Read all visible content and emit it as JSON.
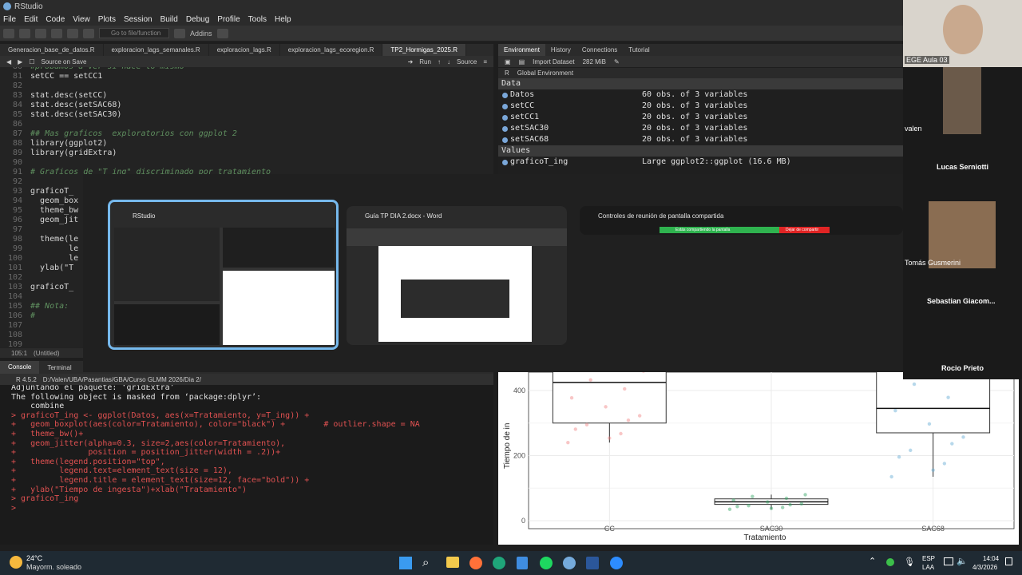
{
  "app": {
    "title": "RStudio"
  },
  "menu": [
    "File",
    "Edit",
    "Code",
    "View",
    "Plots",
    "Session",
    "Build",
    "Debug",
    "Profile",
    "Tools",
    "Help"
  ],
  "toolbar": {
    "goto_placeholder": "Go to file/function",
    "addins": "Addins"
  },
  "source": {
    "tabs": [
      "Generacion_base_de_datos.R",
      "exploracion_lags_semanales.R",
      "exploracion_lags.R",
      "exploracion_lags_ecoregion.R",
      "TP2_Hormigas_2025.R"
    ],
    "source_on_save": "Source on Save",
    "run": "Run",
    "source": "Source",
    "lines": [
      {
        "n": "80",
        "code": "#probamos a ver si hace lo mismo",
        "comment": true
      },
      {
        "n": "81",
        "code": "setCC == setCC1",
        "comment": false
      },
      {
        "n": "82",
        "code": "",
        "comment": false
      },
      {
        "n": "83",
        "code": "stat.desc(setCC)",
        "comment": false
      },
      {
        "n": "84",
        "code": "stat.desc(setSAC68)",
        "comment": false
      },
      {
        "n": "85",
        "code": "stat.desc(setSAC30)",
        "comment": false
      },
      {
        "n": "86",
        "code": "",
        "comment": false
      },
      {
        "n": "87",
        "code": "## Mas graficos  exploratorios con ggplot 2",
        "comment": true
      },
      {
        "n": "88",
        "code": "library(ggplot2)",
        "comment": false
      },
      {
        "n": "89",
        "code": "library(gridExtra)",
        "comment": false
      },
      {
        "n": "90",
        "code": "",
        "comment": false
      },
      {
        "n": "91",
        "code": "# Graficos de \"T_ing\" discriminado por tratamiento",
        "comment": true
      },
      {
        "n": "92",
        "code": "",
        "comment": false
      },
      {
        "n": "93",
        "code": "graficoT_",
        "comment": false
      },
      {
        "n": "94",
        "code": "  geom_box",
        "comment": false
      },
      {
        "n": "95",
        "code": "  theme_bw",
        "comment": false
      },
      {
        "n": "96",
        "code": "  geom_jit",
        "comment": false
      },
      {
        "n": "97",
        "code": "",
        "comment": false
      },
      {
        "n": "98",
        "code": "  theme(le",
        "comment": false
      },
      {
        "n": "99",
        "code": "        le",
        "comment": false
      },
      {
        "n": "100",
        "code": "        le",
        "comment": false
      },
      {
        "n": "101",
        "code": "  ylab(\"T",
        "comment": false
      },
      {
        "n": "102",
        "code": "",
        "comment": false
      },
      {
        "n": "103",
        "code": "graficoT_",
        "comment": false
      },
      {
        "n": "104",
        "code": "",
        "comment": false
      },
      {
        "n": "105",
        "code": "## Nota: ",
        "comment": true
      },
      {
        "n": "106",
        "code": "#",
        "comment": true
      },
      {
        "n": "107",
        "code": "",
        "comment": false
      },
      {
        "n": "108",
        "code": "",
        "comment": false
      },
      {
        "n": "109",
        "code": "",
        "comment": false
      }
    ],
    "status_pos": "105:1",
    "status_scope": "(Untitled)"
  },
  "environment": {
    "tabs": [
      "Environment",
      "History",
      "Connections",
      "Tutorial"
    ],
    "import": "Import Dataset",
    "memory": "282 MiB",
    "lang": "R",
    "scope": "Global Environment",
    "data_header": "Data",
    "values_header": "Values",
    "data": [
      {
        "name": "Datos",
        "value": "60 obs. of 3 variables"
      },
      {
        "name": "setCC",
        "value": "20 obs. of 3 variables"
      },
      {
        "name": "setCC1",
        "value": "20 obs. of 3 variables"
      },
      {
        "name": "setSAC30",
        "value": "20 obs. of 3 variables"
      },
      {
        "name": "setSAC68",
        "value": "20 obs. of 3 variables"
      }
    ],
    "values": [
      {
        "name": "graficoT_ing",
        "value": "Large ggplot2::ggplot (16.6 MB)"
      }
    ]
  },
  "switcher": {
    "windows": [
      {
        "title": "RStudio",
        "selected": true
      },
      {
        "title": "Guía TP DIA 2.docx - Word",
        "selected": false
      },
      {
        "title": "Controles de reunión de pantalla compartida",
        "selected": false
      }
    ],
    "share_left": "Estás compartiendo la pantalla",
    "share_right": "Dejar de compartir"
  },
  "console": {
    "tabs": [
      "Console",
      "Terminal",
      "B"
    ],
    "r_version": "R 4.5.2",
    "path": "D:/Valen/UBA/Pasantias/GBA/Curso GLMM 2026/Dia 2/",
    "lines": [
      {
        "t": "Adjuntando el paquete: ‘gridExtra’",
        "cmd": false
      },
      {
        "t": "",
        "cmd": false
      },
      {
        "t": "The following object is masked from ‘package:dplyr’:",
        "cmd": false
      },
      {
        "t": "",
        "cmd": false
      },
      {
        "t": "    combine",
        "cmd": false
      },
      {
        "t": "",
        "cmd": false
      },
      {
        "t": "> graficoT_ing <- ggplot(Datos, aes(x=Tratamiento, y=T_ing)) +",
        "cmd": true
      },
      {
        "t": "+   geom_boxplot(aes(color=Tratamiento), color=\"black\") +        # outlier.shape = NA",
        "cmd": true
      },
      {
        "t": "+   theme_bw()+",
        "cmd": true
      },
      {
        "t": "+   geom_jitter(alpha=0.3, size=2,aes(color=Tratamiento),",
        "cmd": true
      },
      {
        "t": "+               position = position_jitter(width = .2))+",
        "cmd": true
      },
      {
        "t": "+   theme(legend.position=\"top\",",
        "cmd": true
      },
      {
        "t": "+         legend.text=element_text(size = 12),",
        "cmd": true
      },
      {
        "t": "+         legend.title = element_text(size=12, face=\"bold\")) +",
        "cmd": true
      },
      {
        "t": "+   ylab(\"Tiempo de ingesta\")+xlab(\"Tratamiento\")",
        "cmd": true
      },
      {
        "t": "> graficoT_ing",
        "cmd": true
      },
      {
        "t": ">",
        "cmd": true
      }
    ]
  },
  "chart_data": {
    "type": "box",
    "categories": [
      "CC",
      "SAC30",
      "SAC68"
    ],
    "xlabel": "Tratamiento",
    "ylabel": "Tiempo de in",
    "y_ticks": [
      0,
      200,
      400
    ],
    "boxes": [
      {
        "name": "CC",
        "q1": 300,
        "median": 425,
        "q3": 460,
        "whisker_low": 240,
        "whisker_high": 460
      },
      {
        "name": "SAC30",
        "q1": 50,
        "median": 58,
        "q3": 67,
        "whisker_low": 35,
        "whisker_high": 80
      },
      {
        "name": "SAC68",
        "q1": 270,
        "median": 345,
        "q3": 460,
        "whisker_low": 135,
        "whisker_high": 460
      }
    ],
    "colors": {
      "CC": "#f08080",
      "SAC30": "#2ca25f",
      "SAC68": "#5fa8d3"
    }
  },
  "zoom": {
    "self_label": "EGE Aula 03",
    "participants": [
      "valen",
      "Lucas Serniotti",
      "Tomás Gusmerini",
      "Sebastian  Giacom...",
      "Rocio Prieto"
    ]
  },
  "taskbar": {
    "weather_temp": "24°C",
    "weather_desc": "Mayorm. soleado",
    "lang1": "ESP",
    "lang2": "LAA",
    "time": "14:04",
    "date": "4/3/2026"
  }
}
